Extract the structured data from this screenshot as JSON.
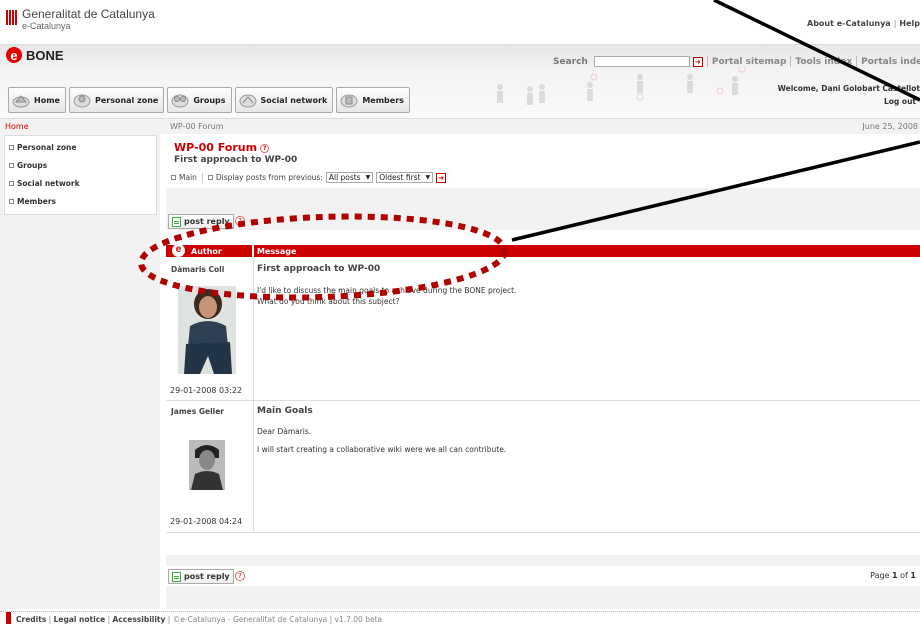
{
  "top": {
    "org_name": "Generalitat de Catalunya",
    "org_sub": "e-Catalunya",
    "links": [
      "About e-Catalunya",
      "Help"
    ]
  },
  "header": {
    "app_name": "BONE",
    "search_label": "Search",
    "search_value": "",
    "links": [
      "Portal sitemap",
      "Tools index",
      "Portals index"
    ],
    "welcome": "Welcome, Dani Golobart Castellot",
    "logout": "Log out"
  },
  "nav": {
    "tabs": [
      {
        "label": "Home",
        "icon": "home-icon"
      },
      {
        "label": "Personal zone",
        "icon": "personal-zone-icon"
      },
      {
        "label": "Groups",
        "icon": "groups-icon"
      },
      {
        "label": "Social network",
        "icon": "social-network-icon"
      },
      {
        "label": "Members",
        "icon": "members-icon"
      }
    ]
  },
  "breadcrumb": {
    "home": "Home",
    "forum": "WP-00 Forum",
    "date": "June 25, 2008"
  },
  "sidebar": {
    "items": [
      "Personal zone",
      "Groups",
      "Social network",
      "Members"
    ]
  },
  "forum": {
    "title": "WP-00 Forum",
    "subtitle": "First approach to WP-00",
    "main_link": "Main",
    "display_label": "Display posts from previous:",
    "period_value": "All posts",
    "order_value": "Oldest first"
  },
  "posts_table": {
    "author_header": "Author",
    "message_header": "Message",
    "post_reply": "post reply",
    "posts": [
      {
        "author": "Dàmaris Coll",
        "subject": "First approach to WP-00",
        "body": [
          "I'd like to discuss the main goals to achieve during the BONE project.",
          "What do you think about this subject?"
        ],
        "date": "29-01-2008 03:22"
      },
      {
        "author": "James Geller",
        "subject": "Main Goals",
        "body": [
          "Dear Dàmaris.",
          "I will start creating a collaborative wiki were we all can contribute."
        ],
        "date": "29-01-2008 04:24"
      }
    ],
    "page_label": "Page",
    "page_current": "1",
    "page_of": "of",
    "page_total": "1"
  },
  "footer": {
    "links": [
      "Credits",
      "Legal notice",
      "Accessibility"
    ],
    "copyright": "©e-Catalunya - Generalitat de Catalunya | v1.7.00 beta"
  },
  "colors": {
    "accent": "#cc0000",
    "annotation": "#b00000"
  }
}
